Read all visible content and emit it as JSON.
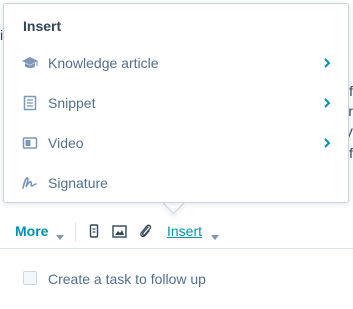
{
  "colors": {
    "accent": "#0091ae",
    "text_dark": "#33475b",
    "text_muted": "#516f90",
    "icon": "#7c98b6",
    "border": "#cbd6e2"
  },
  "background_fragments": [
    "i",
    "f",
    "r",
    "V",
    "f"
  ],
  "insert_menu": {
    "header": "Insert",
    "items": [
      {
        "label": "Knowledge article",
        "icon": "graduation-cap-icon",
        "has_submenu": true
      },
      {
        "label": "Snippet",
        "icon": "document-icon",
        "has_submenu": true
      },
      {
        "label": "Video",
        "icon": "video-icon",
        "has_submenu": true
      },
      {
        "label": "Signature",
        "icon": "signature-icon",
        "has_submenu": false
      }
    ]
  },
  "toolbar": {
    "more_label": "More",
    "insert_label": "Insert",
    "icons": [
      "mobile-icon",
      "image-icon",
      "paperclip-icon"
    ]
  },
  "task": {
    "checkbox_label": "Create a task to follow up",
    "checked": false
  }
}
